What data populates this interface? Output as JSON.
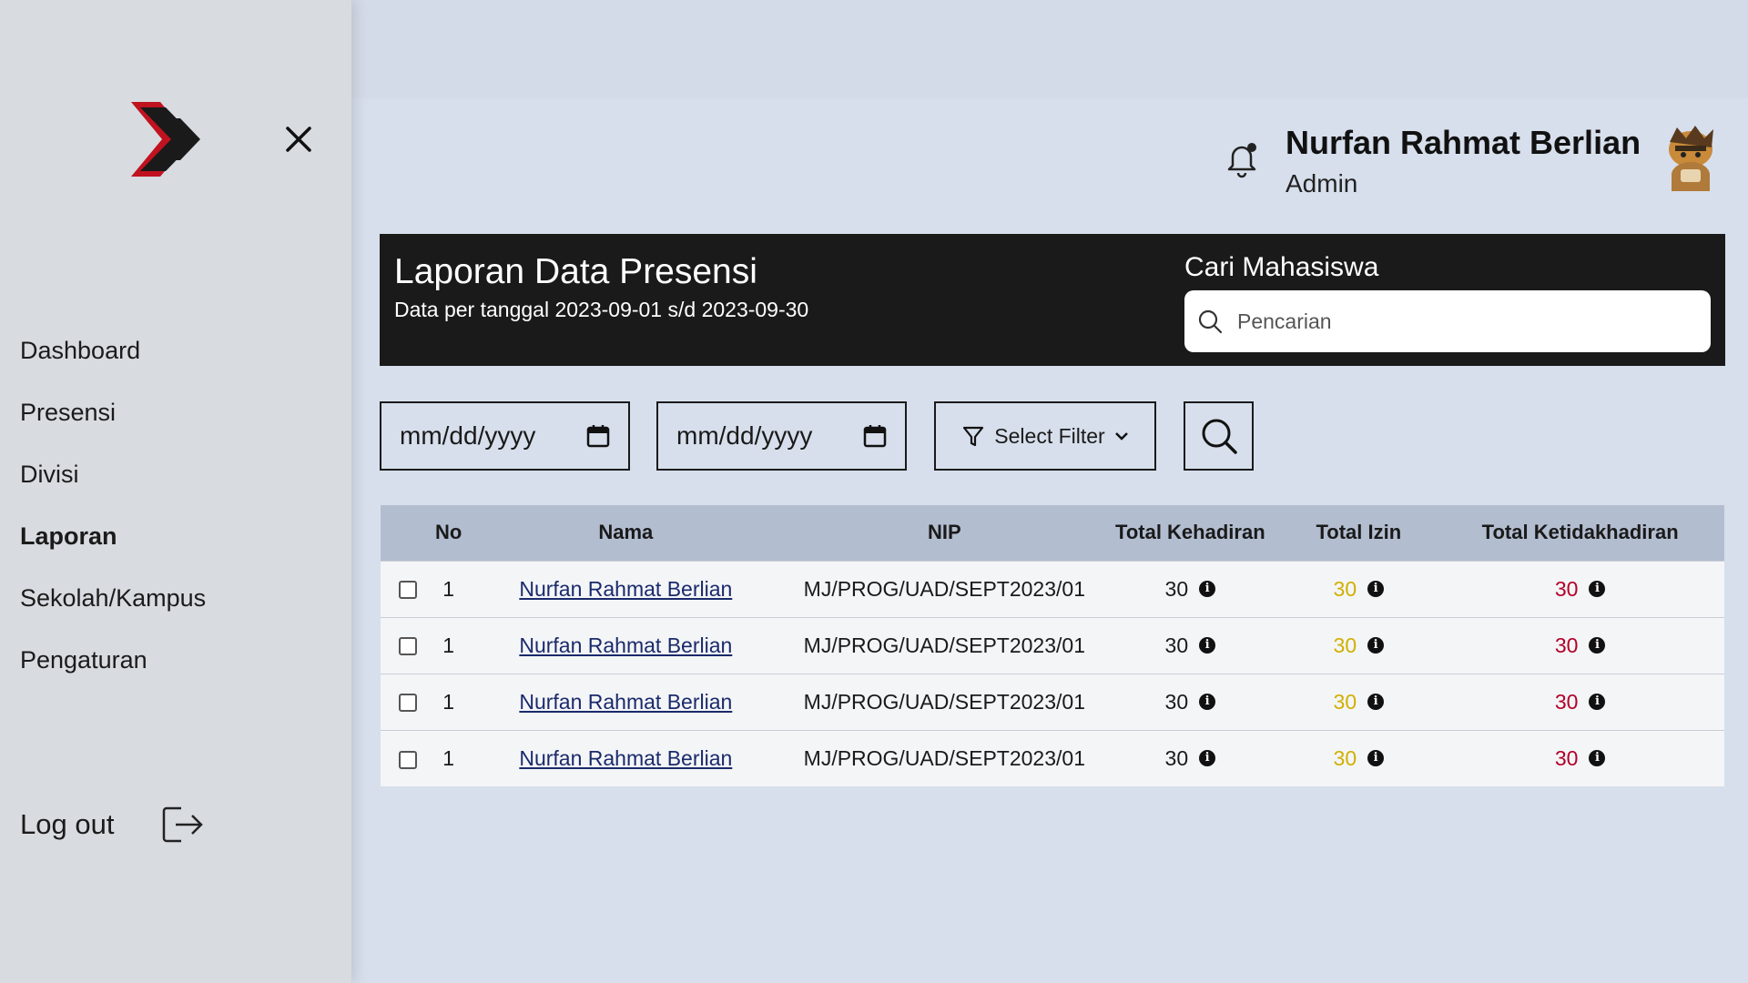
{
  "sidebar": {
    "nav": [
      "Dashboard",
      "Presensi",
      "Divisi",
      "Laporan",
      "Sekolah/Kampus",
      "Pengaturan"
    ],
    "active_item": "Laporan",
    "logout_label": "Log out",
    "icons": {
      "logo": "chevron-logo",
      "close": "close-icon",
      "logout": "logout-icon"
    },
    "colors": {
      "logo_accent": "#c0121f",
      "logo_dark": "#1a1a1a"
    }
  },
  "header": {
    "user_name": "Nurfan Rahmat Berlian",
    "user_role": "Admin",
    "icons": {
      "notification": "bell-icon",
      "avatar": "avatar"
    }
  },
  "report": {
    "title": "Laporan Data Presensi",
    "subtitle": "Data per tanggal 2023-09-01 s/d 2023-09-30",
    "search_label": "Cari Mahasiswa",
    "search_placeholder": "Pencarian"
  },
  "filters": {
    "start_date_placeholder": "mm/dd/yyyy",
    "end_date_placeholder": "mm/dd/yyyy",
    "select_filter_label": "Select Filter"
  },
  "table": {
    "columns": [
      "No",
      "Nama",
      "NIP",
      "Total Kehadiran",
      "Total Izin",
      "Total Ketidakhadiran"
    ],
    "rows": [
      {
        "no": "1",
        "nama": "Nurfan Rahmat Berlian",
        "nip": "MJ/PROG/UAD/SEPT2023/01",
        "kehadiran": "30",
        "izin": "30",
        "ketidakhadiran": "30"
      },
      {
        "no": "1",
        "nama": "Nurfan Rahmat Berlian",
        "nip": "MJ/PROG/UAD/SEPT2023/01",
        "kehadiran": "30",
        "izin": "30",
        "ketidakhadiran": "30"
      },
      {
        "no": "1",
        "nama": "Nurfan Rahmat Berlian",
        "nip": "MJ/PROG/UAD/SEPT2023/01",
        "kehadiran": "30",
        "izin": "30",
        "ketidakhadiran": "30"
      },
      {
        "no": "1",
        "nama": "Nurfan Rahmat Berlian",
        "nip": "MJ/PROG/UAD/SEPT2023/01",
        "kehadiran": "30",
        "izin": "30",
        "ketidakhadiran": "30"
      }
    ],
    "colors": {
      "izin": "#d1b000",
      "ketidakhadiran": "#b2002a",
      "header_bg": "#b3bdd0"
    }
  }
}
